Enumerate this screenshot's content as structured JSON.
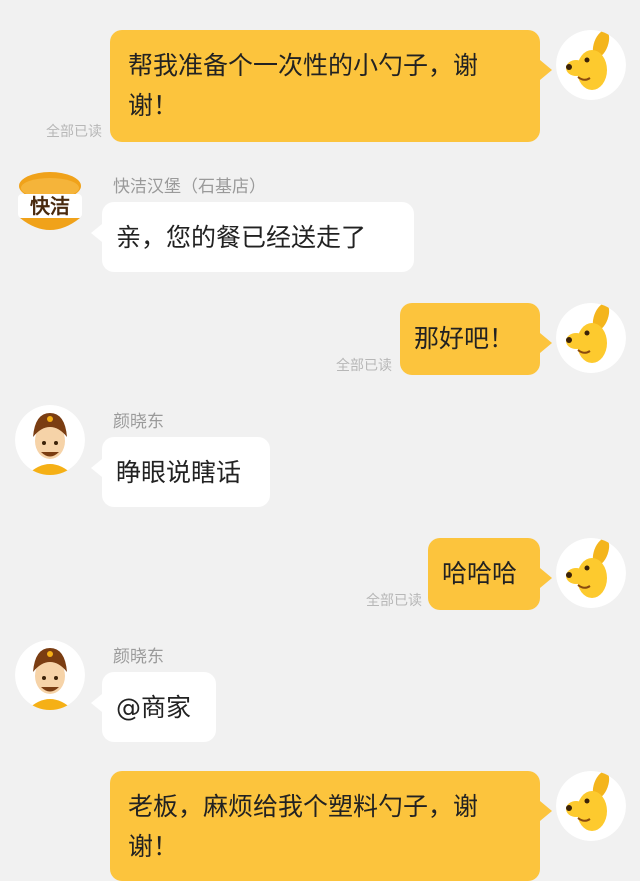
{
  "messages": [
    {
      "direction": "outgoing",
      "text": "帮我准备个一次性的小勺子，谢谢！",
      "status": "全部已读"
    },
    {
      "direction": "incoming",
      "sender": "快洁汉堡（石基店）",
      "text": "亲，您的餐已经送走了",
      "avatar": "burger-shop-logo",
      "logo_text": "快洁"
    },
    {
      "direction": "outgoing",
      "text": "那好吧！",
      "status": "全部已读"
    },
    {
      "direction": "incoming",
      "sender": "颜晓东",
      "text": "睁眼说瞎话",
      "avatar": "courier-avatar"
    },
    {
      "direction": "outgoing",
      "text": "哈哈哈",
      "status": "全部已读"
    },
    {
      "direction": "incoming",
      "sender": "颜晓东",
      "text": "@商家",
      "avatar": "courier-avatar"
    },
    {
      "direction": "outgoing",
      "text": "老板，麻烦给我个塑料勺子，谢谢！",
      "status": ""
    }
  ],
  "colors": {
    "outgoing_bubble": "#fcc43d",
    "incoming_bubble": "#ffffff",
    "background": "#f1f1f1"
  }
}
